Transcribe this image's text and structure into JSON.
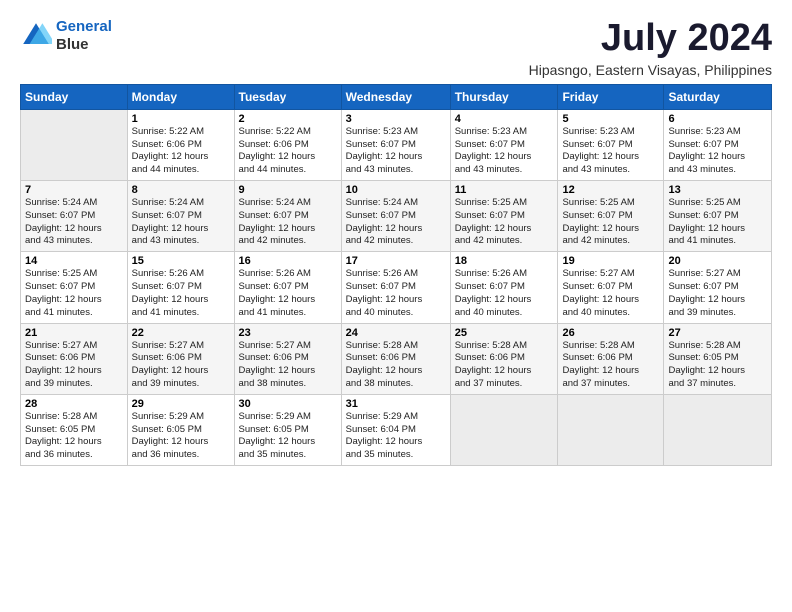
{
  "logo": {
    "line1": "General",
    "line2": "Blue"
  },
  "title": "July 2024",
  "location": "Hipasngo, Eastern Visayas, Philippines",
  "days_header": [
    "Sunday",
    "Monday",
    "Tuesday",
    "Wednesday",
    "Thursday",
    "Friday",
    "Saturday"
  ],
  "weeks": [
    [
      {
        "num": "",
        "info": ""
      },
      {
        "num": "1",
        "info": "Sunrise: 5:22 AM\nSunset: 6:06 PM\nDaylight: 12 hours\nand 44 minutes."
      },
      {
        "num": "2",
        "info": "Sunrise: 5:22 AM\nSunset: 6:06 PM\nDaylight: 12 hours\nand 44 minutes."
      },
      {
        "num": "3",
        "info": "Sunrise: 5:23 AM\nSunset: 6:07 PM\nDaylight: 12 hours\nand 43 minutes."
      },
      {
        "num": "4",
        "info": "Sunrise: 5:23 AM\nSunset: 6:07 PM\nDaylight: 12 hours\nand 43 minutes."
      },
      {
        "num": "5",
        "info": "Sunrise: 5:23 AM\nSunset: 6:07 PM\nDaylight: 12 hours\nand 43 minutes."
      },
      {
        "num": "6",
        "info": "Sunrise: 5:23 AM\nSunset: 6:07 PM\nDaylight: 12 hours\nand 43 minutes."
      }
    ],
    [
      {
        "num": "7",
        "info": "Sunrise: 5:24 AM\nSunset: 6:07 PM\nDaylight: 12 hours\nand 43 minutes."
      },
      {
        "num": "8",
        "info": "Sunrise: 5:24 AM\nSunset: 6:07 PM\nDaylight: 12 hours\nand 43 minutes."
      },
      {
        "num": "9",
        "info": "Sunrise: 5:24 AM\nSunset: 6:07 PM\nDaylight: 12 hours\nand 42 minutes."
      },
      {
        "num": "10",
        "info": "Sunrise: 5:24 AM\nSunset: 6:07 PM\nDaylight: 12 hours\nand 42 minutes."
      },
      {
        "num": "11",
        "info": "Sunrise: 5:25 AM\nSunset: 6:07 PM\nDaylight: 12 hours\nand 42 minutes."
      },
      {
        "num": "12",
        "info": "Sunrise: 5:25 AM\nSunset: 6:07 PM\nDaylight: 12 hours\nand 42 minutes."
      },
      {
        "num": "13",
        "info": "Sunrise: 5:25 AM\nSunset: 6:07 PM\nDaylight: 12 hours\nand 41 minutes."
      }
    ],
    [
      {
        "num": "14",
        "info": "Sunrise: 5:25 AM\nSunset: 6:07 PM\nDaylight: 12 hours\nand 41 minutes."
      },
      {
        "num": "15",
        "info": "Sunrise: 5:26 AM\nSunset: 6:07 PM\nDaylight: 12 hours\nand 41 minutes."
      },
      {
        "num": "16",
        "info": "Sunrise: 5:26 AM\nSunset: 6:07 PM\nDaylight: 12 hours\nand 41 minutes."
      },
      {
        "num": "17",
        "info": "Sunrise: 5:26 AM\nSunset: 6:07 PM\nDaylight: 12 hours\nand 40 minutes."
      },
      {
        "num": "18",
        "info": "Sunrise: 5:26 AM\nSunset: 6:07 PM\nDaylight: 12 hours\nand 40 minutes."
      },
      {
        "num": "19",
        "info": "Sunrise: 5:27 AM\nSunset: 6:07 PM\nDaylight: 12 hours\nand 40 minutes."
      },
      {
        "num": "20",
        "info": "Sunrise: 5:27 AM\nSunset: 6:07 PM\nDaylight: 12 hours\nand 39 minutes."
      }
    ],
    [
      {
        "num": "21",
        "info": "Sunrise: 5:27 AM\nSunset: 6:06 PM\nDaylight: 12 hours\nand 39 minutes."
      },
      {
        "num": "22",
        "info": "Sunrise: 5:27 AM\nSunset: 6:06 PM\nDaylight: 12 hours\nand 39 minutes."
      },
      {
        "num": "23",
        "info": "Sunrise: 5:27 AM\nSunset: 6:06 PM\nDaylight: 12 hours\nand 38 minutes."
      },
      {
        "num": "24",
        "info": "Sunrise: 5:28 AM\nSunset: 6:06 PM\nDaylight: 12 hours\nand 38 minutes."
      },
      {
        "num": "25",
        "info": "Sunrise: 5:28 AM\nSunset: 6:06 PM\nDaylight: 12 hours\nand 37 minutes."
      },
      {
        "num": "26",
        "info": "Sunrise: 5:28 AM\nSunset: 6:06 PM\nDaylight: 12 hours\nand 37 minutes."
      },
      {
        "num": "27",
        "info": "Sunrise: 5:28 AM\nSunset: 6:05 PM\nDaylight: 12 hours\nand 37 minutes."
      }
    ],
    [
      {
        "num": "28",
        "info": "Sunrise: 5:28 AM\nSunset: 6:05 PM\nDaylight: 12 hours\nand 36 minutes."
      },
      {
        "num": "29",
        "info": "Sunrise: 5:29 AM\nSunset: 6:05 PM\nDaylight: 12 hours\nand 36 minutes."
      },
      {
        "num": "30",
        "info": "Sunrise: 5:29 AM\nSunset: 6:05 PM\nDaylight: 12 hours\nand 35 minutes."
      },
      {
        "num": "31",
        "info": "Sunrise: 5:29 AM\nSunset: 6:04 PM\nDaylight: 12 hours\nand 35 minutes."
      },
      {
        "num": "",
        "info": ""
      },
      {
        "num": "",
        "info": ""
      },
      {
        "num": "",
        "info": ""
      }
    ]
  ]
}
